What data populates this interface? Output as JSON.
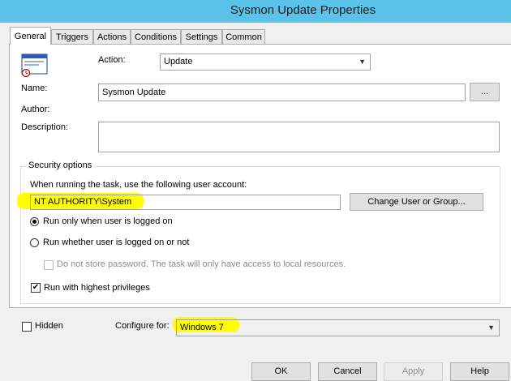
{
  "window": {
    "title": "Sysmon Update Properties"
  },
  "tabs": [
    {
      "label": "General"
    },
    {
      "label": "Triggers"
    },
    {
      "label": "Actions"
    },
    {
      "label": "Conditions"
    },
    {
      "label": "Settings"
    },
    {
      "label": "Common"
    }
  ],
  "general": {
    "action_label": "Action:",
    "action_value": "Update",
    "name_label": "Name:",
    "name_value": "Sysmon Update",
    "browse_label": "...",
    "author_label": "Author:",
    "description_label": "Description:",
    "description_value": ""
  },
  "security": {
    "group_label": "Security options",
    "account_prompt": "When running the task, use the following user account:",
    "account_value": "NT AUTHORITY\\System",
    "change_user_label": "Change User or Group...",
    "radio_logged_on": "Run only when user is logged on",
    "radio_whether": "Run whether user is logged on or not",
    "no_store_password": "Do not store password. The task will only have access to local resources.",
    "highest_privileges": "Run with highest privileges"
  },
  "bottom": {
    "hidden_label": "Hidden",
    "configure_label": "Configure for:",
    "configure_value": "Windows 7"
  },
  "footer": {
    "ok_label": "OK",
    "cancel_label": "Cancel",
    "apply_label": "Apply",
    "help_label": "Help"
  },
  "colors": {
    "titlebar": "#5bc3ea",
    "highlight": "#ffff00"
  }
}
